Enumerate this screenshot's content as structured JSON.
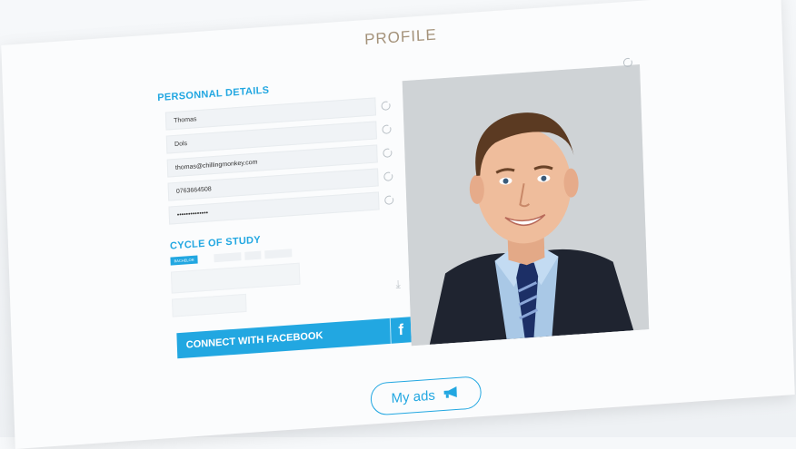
{
  "page": {
    "title": "PROFILE"
  },
  "personal": {
    "label": "PERSONNAL DETAILS",
    "fields": [
      {
        "value": "Thomas"
      },
      {
        "value": "Dols"
      },
      {
        "value": "thomas@chillingmonkey.com"
      },
      {
        "value": "0763664508"
      },
      {
        "value": "••••••••••••••"
      }
    ]
  },
  "study": {
    "label": "CYCLE OF STUDY",
    "options": [
      "BACHELOR"
    ]
  },
  "facebook": {
    "label": "CONNECT WITH FACEBOOK",
    "icon_glyph": "f"
  },
  "actions": {
    "myads_label": "My ads"
  },
  "colors": {
    "accent": "#22a7e1",
    "title": "#a4927a"
  }
}
